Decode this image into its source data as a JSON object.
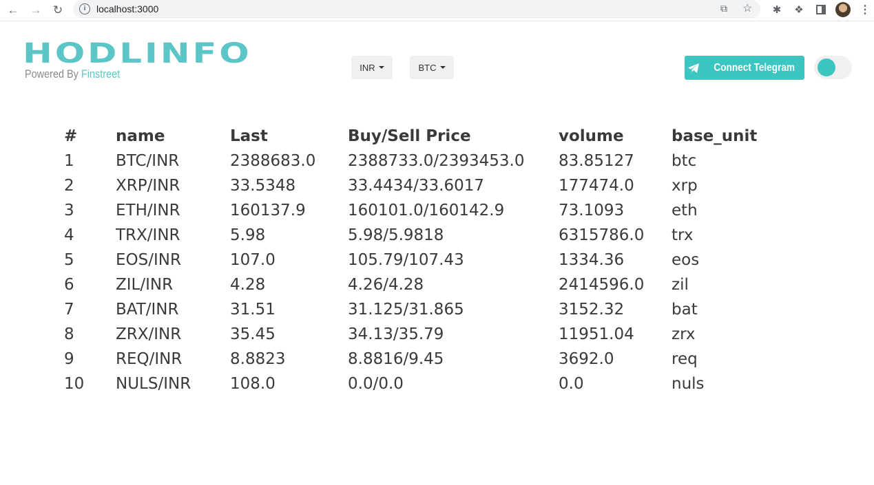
{
  "browser": {
    "url": "localhost:3000",
    "icons": [
      "back-icon",
      "forward-icon",
      "reload-icon",
      "info-icon",
      "share-icon",
      "star-icon",
      "bug-icon",
      "puzzle-icon",
      "sidebar-icon",
      "avatar",
      "menu-icon"
    ]
  },
  "header": {
    "logo": "HODLINFO",
    "powered_prefix": "Powered By",
    "powered_brand": "Finstreet",
    "currency_select": "INR",
    "coin_select": "BTC",
    "telegram_label": "Connect Telegram"
  },
  "colors": {
    "accent": "#3dc6c1",
    "text": "#3a3a3a"
  },
  "table": {
    "columns": [
      "#",
      "name",
      "Last",
      "Buy/Sell Price",
      "volume",
      "base_unit"
    ],
    "rows": [
      [
        "1",
        "BTC/INR",
        "2388683.0",
        "2388733.0/2393453.0",
        "83.85127",
        "btc"
      ],
      [
        "2",
        "XRP/INR",
        "33.5348",
        "33.4434/33.6017",
        "177474.0",
        "xrp"
      ],
      [
        "3",
        "ETH/INR",
        "160137.9",
        "160101.0/160142.9",
        "73.1093",
        "eth"
      ],
      [
        "4",
        "TRX/INR",
        "5.98",
        "5.98/5.9818",
        "6315786.0",
        "trx"
      ],
      [
        "5",
        "EOS/INR",
        "107.0",
        "105.79/107.43",
        "1334.36",
        "eos"
      ],
      [
        "6",
        "ZIL/INR",
        "4.28",
        "4.26/4.28",
        "2414596.0",
        "zil"
      ],
      [
        "7",
        "BAT/INR",
        "31.51",
        "31.125/31.865",
        "3152.32",
        "bat"
      ],
      [
        "8",
        "ZRX/INR",
        "35.45",
        "34.13/35.79",
        "11951.04",
        "zrx"
      ],
      [
        "9",
        "REQ/INR",
        "8.8823",
        "8.8816/9.45",
        "3692.0",
        "req"
      ],
      [
        "10",
        "NULS/INR",
        "108.0",
        "0.0/0.0",
        "0.0",
        "nuls"
      ]
    ]
  }
}
